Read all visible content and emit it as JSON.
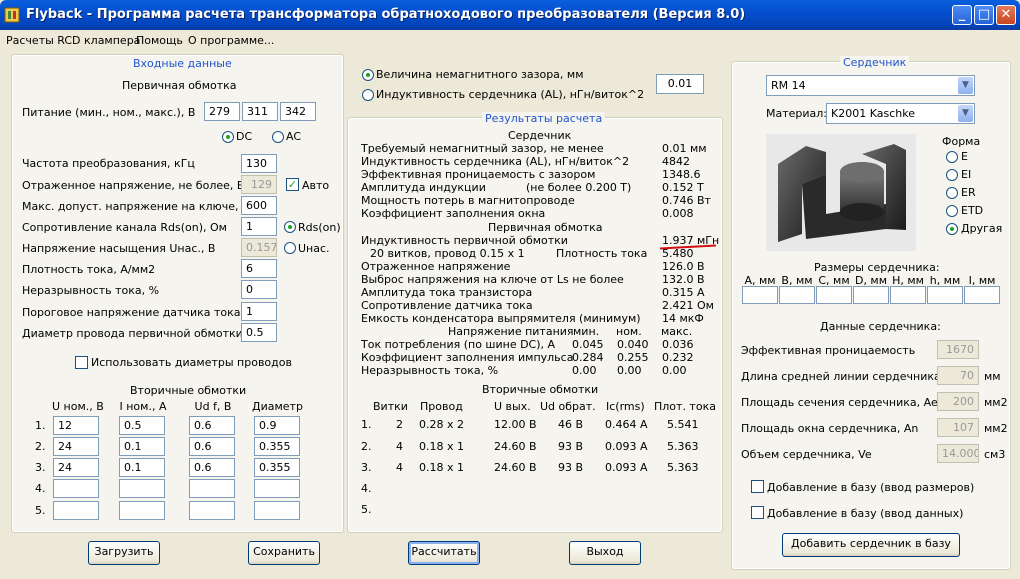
{
  "window": {
    "title": "Flyback - Программа расчета трансформатора обратноходового преобразователя (Версия 8.0)"
  },
  "menu": [
    "Расчеты RCD клампера",
    "Помощь",
    "О программе..."
  ],
  "input": {
    "title": "Входные данные",
    "primary_title": "Первичная обмотка",
    "supply_label": "Питание (мин., ном., макс.), В",
    "supply": [
      "279",
      "311",
      "342"
    ],
    "dc": "DC",
    "ac": "AC",
    "rows": [
      {
        "label": "Частота преобразования, кГц",
        "value": "130"
      },
      {
        "label": "Отраженное напряжение, не более, В",
        "value": "129"
      },
      {
        "label": "Макс. допуст. напряжение на ключе, В",
        "value": "600"
      },
      {
        "label": "Сопротивление канала Rds(on), Ом",
        "value": "1"
      },
      {
        "label": "Напряжение насыщения Uнас., В",
        "value": "0.157"
      },
      {
        "label": "Плотность тока, А/мм2",
        "value": "6"
      },
      {
        "label": "Неразрывность тока, %",
        "value": "0"
      },
      {
        "label": "Пороговое напряжение датчика тока, В",
        "value": "1"
      },
      {
        "label": "Диаметр провода первичной обмотки",
        "value": "0.5"
      }
    ],
    "auto": "Авто",
    "rds_opt": "Rds(on)",
    "unas_opt": "Uнас.",
    "use_diam": "Использовать диаметры проводов",
    "secondary_title": "Вторичные обмотки",
    "sec_headers": [
      "U ном., В",
      "I ном., А",
      "Ud f, В",
      "Диаметр"
    ],
    "sec_rows": [
      {
        "n": "1.",
        "u": "12",
        "i": "0.5",
        "ud": "0.6",
        "d": "0.9"
      },
      {
        "n": "2.",
        "u": "24",
        "i": "0.1",
        "ud": "0.6",
        "d": "0.355"
      },
      {
        "n": "3.",
        "u": "24",
        "i": "0.1",
        "ud": "0.6",
        "d": "0.355"
      },
      {
        "n": "4.",
        "u": "",
        "i": "",
        "ud": "",
        "d": ""
      },
      {
        "n": "5.",
        "u": "",
        "i": "",
        "ud": "",
        "d": ""
      }
    ]
  },
  "gap": {
    "opt1": "Величина немагнитного зазора, мм",
    "opt2": "Индуктивность сердечника (AL), нГн/виток^2",
    "value": "0.01"
  },
  "results": {
    "title": "Результаты расчета",
    "core_title": "Сердечник",
    "core_rows": [
      {
        "label": "Требуемый немагнитный зазор, не менее",
        "value": "0.01 мм"
      },
      {
        "label": "Индуктивность сердечника (AL), нГн/виток^2",
        "value": "4842"
      },
      {
        "label": "Эффективная проницаемость с зазором",
        "value": "1348.6"
      },
      {
        "label": "Амплитуда индукции",
        "mid": "(не более 0.200 Т)",
        "value": "0.152 Т"
      },
      {
        "label": "Мощность потерь в магнитопроводе",
        "value": "0.746 Вт"
      },
      {
        "label": "Коэффициент заполнения окна",
        "value": "0.008"
      }
    ],
    "primary_title": "Первичная обмотка",
    "ind_label": "Индуктивность первичной обмотки",
    "ind_value": "1.937 мГн",
    "turns_label": "20 витков, провод 0.15 x 1",
    "density_label": "Плотность тока",
    "density_value": "5.480",
    "prim_rows": [
      {
        "label": "Отраженное напряжение",
        "value": "126.0 В"
      },
      {
        "label": "Выброс напряжения на ключе от Ls не более",
        "value": "132.0 В"
      },
      {
        "label": "Амплитуда тока транзистора",
        "value": "0.315 А"
      },
      {
        "label": "Сопротивление датчика тока",
        "value": "2.421 Ом"
      },
      {
        "label": "Емкость конденсатора выпрямителя (минимум)",
        "value": "14 мкФ"
      }
    ],
    "supply_header": "Напряжение питания",
    "col_min": "мин.",
    "col_nom": "ном.",
    "col_max": "макс.",
    "supply_rows": [
      {
        "label": "Ток потребления (по шине DC), А",
        "min": "0.045",
        "nom": "0.040",
        "max": "0.036"
      },
      {
        "label": "Коэффициент заполнения импульса",
        "min": "0.284",
        "nom": "0.255",
        "max": "0.232"
      },
      {
        "label": "Неразрывность тока, %",
        "min": "0.00",
        "nom": "0.00",
        "max": "0.00"
      }
    ],
    "sec_title": "Вторичные обмотки",
    "sec_headers": [
      "Витки",
      "Провод",
      "U вых.",
      "Ud обрат.",
      "Ic(rms)",
      "Плот. тока"
    ],
    "sec_rows": [
      {
        "n": "1.",
        "turns": "2",
        "wire": "0.28 x 2",
        "u": "12.00 В",
        "ud": "46 В",
        "ic": "0.464 А",
        "j": "5.541"
      },
      {
        "n": "2.",
        "turns": "4",
        "wire": "0.18 x 1",
        "u": "24.60 В",
        "ud": "93 В",
        "ic": "0.093 А",
        "j": "5.363"
      },
      {
        "n": "3.",
        "turns": "4",
        "wire": "0.18 x 1",
        "u": "24.60 В",
        "ud": "93 В",
        "ic": "0.093 А",
        "j": "5.363"
      },
      {
        "n": "4.",
        "turns": "",
        "wire": "",
        "u": "",
        "ud": "",
        "ic": "",
        "j": ""
      },
      {
        "n": "5.",
        "turns": "",
        "wire": "",
        "u": "",
        "ud": "",
        "ic": "",
        "j": ""
      }
    ]
  },
  "core": {
    "title": "Сердечник",
    "type": "RM 14",
    "material_label": "Материал:",
    "material": "K2001 Kaschke",
    "shape_label": "Форма",
    "shapes": [
      {
        "label": "E",
        "selected": false
      },
      {
        "label": "EI",
        "selected": false
      },
      {
        "label": "ER",
        "selected": false
      },
      {
        "label": "ETD",
        "selected": false
      },
      {
        "label": "Другая",
        "selected": true
      }
    ],
    "dims_title": "Размеры сердечника:",
    "dims": [
      "A, мм",
      "B, мм",
      "C, мм",
      "D, мм",
      "H, мм",
      "h, мм",
      "I, мм"
    ],
    "data_title": "Данные сердечника:",
    "data_rows": [
      {
        "label": "Эффективная проницаемость",
        "value": "1670",
        "unit": ""
      },
      {
        "label": "Длина средней линии сердечника, le",
        "value": "70",
        "unit": "мм"
      },
      {
        "label": "Площадь сечения сердечника, Ae",
        "value": "200",
        "unit": "мм2"
      },
      {
        "label": "Площадь окна сердечника, An",
        "value": "107",
        "unit": "мм2"
      },
      {
        "label": "Объем сердечника, Ve",
        "value": "14.000",
        "unit": "см3"
      }
    ],
    "chk1": "Добавление в базу (ввод размеров)",
    "chk2": "Добавление в базу (ввод данных)",
    "add_btn": "Добавить сердечник в базу"
  },
  "buttons": {
    "load": "Загрузить",
    "save": "Сохранить",
    "calc": "Рассчитать",
    "exit": "Выход"
  },
  "colors": {
    "accent": "#2255cc",
    "highlight": "#d01010",
    "titlebar": "#0450d0"
  }
}
